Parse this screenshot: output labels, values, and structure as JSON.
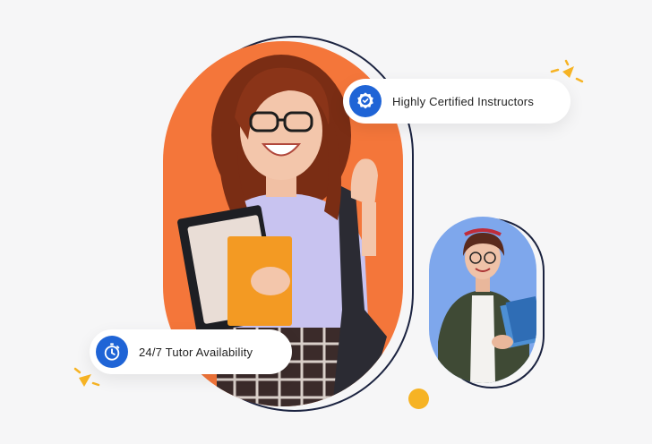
{
  "badges": {
    "certified": {
      "label": "Highly Certified Instructors",
      "icon": "certified-badge-icon"
    },
    "tutor": {
      "label": "24/7 Tutor Availability",
      "icon": "stopwatch-icon"
    }
  },
  "colors": {
    "background": "#f6f6f7",
    "main_pill": "#f4763a",
    "small_pill": "#7ea7ec",
    "outline": "#1b2340",
    "icon_bg": "#1f64d6",
    "accent_yellow": "#f6b324"
  },
  "images": {
    "main": "student-with-notebooks-ok-gesture",
    "secondary": "student-holding-books"
  }
}
